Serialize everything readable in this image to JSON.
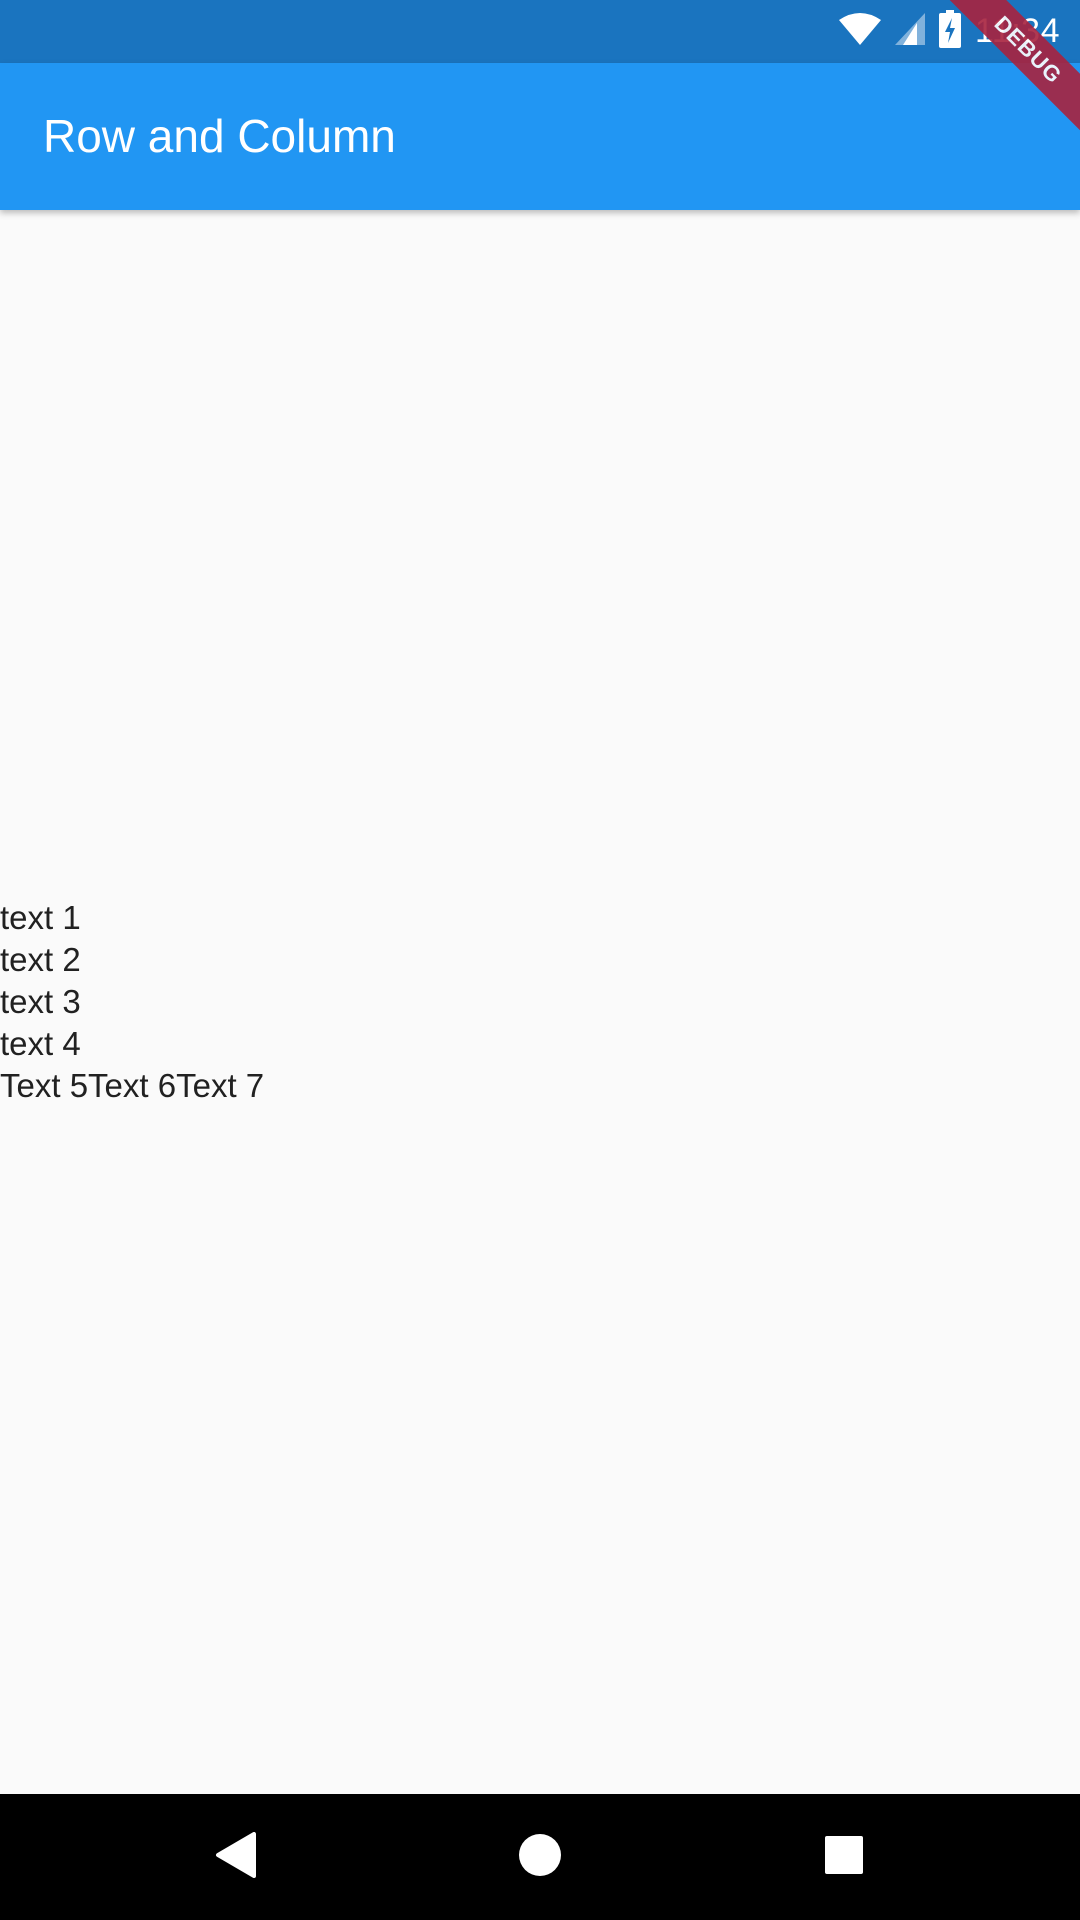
{
  "status_bar": {
    "time": "11:34",
    "icons": [
      "wifi-icon",
      "cellular-signal-icon",
      "battery-charging-icon"
    ],
    "background_color": "#1a74bf"
  },
  "app_bar": {
    "title": "Row and Column",
    "background_color": "#2196f3"
  },
  "debug_banner": {
    "label": "DEBUG",
    "color": "#a8233f"
  },
  "content": {
    "column_items": [
      "text 1",
      "text 2",
      "text 3",
      "text 4"
    ],
    "row_items": [
      "Text 5",
      "Text 6",
      "Text 7"
    ]
  },
  "nav_bar": {
    "buttons": [
      "back-icon",
      "home-icon",
      "recents-icon"
    ]
  }
}
